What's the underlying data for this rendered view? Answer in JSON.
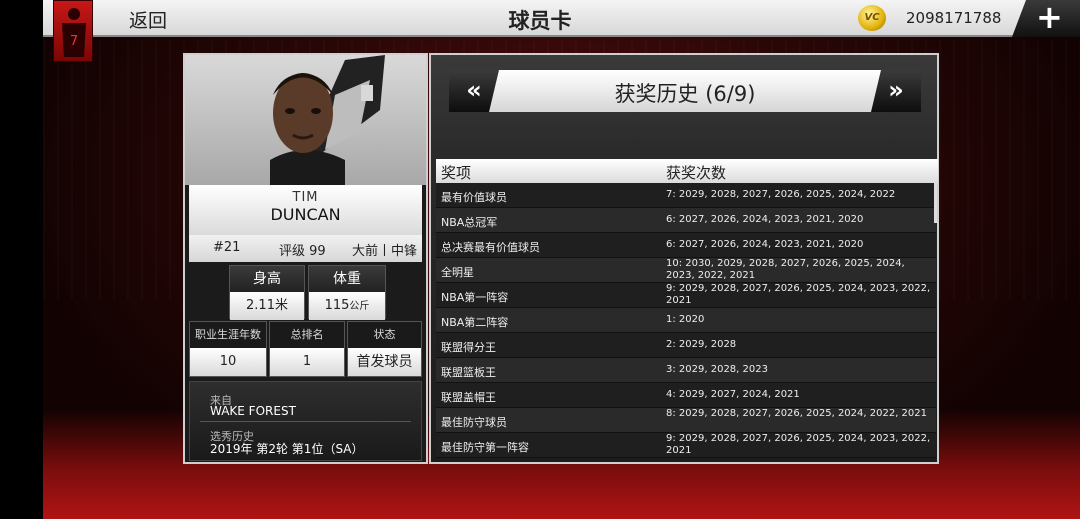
{
  "topbar": {
    "back_label": "返回",
    "title": "球员卡",
    "coin_label": "VC",
    "currency": "2098171788",
    "add_label": "+"
  },
  "player": {
    "first_name": "TIM",
    "last_name": "DUNCAN",
    "number": "#21",
    "rating": "评级 99",
    "position": "大前丨中锋",
    "height_label": "身高",
    "height_value": "2.11米",
    "weight_label": "体重",
    "weight_value": "115",
    "weight_unit": "公斤",
    "career_label": "职业生涯年数",
    "career_value": "10",
    "rank_label": "总排名",
    "rank_value": "1",
    "status_label": "状态",
    "status_value": "首发球员",
    "from_label": "来自",
    "from_value": "WAKE FOREST",
    "draft_label": "选秀历史",
    "draft_value": "2019年 第2轮 第1位（SA）"
  },
  "awards": {
    "title": "获奖历史 (6/9)",
    "prev_label": "«",
    "next_label": "»",
    "col_award": "奖项",
    "col_count": "获奖次数",
    "rows": [
      {
        "name": "最有价值球员",
        "count": "7: 2029, 2028, 2027, 2026, 2025, 2024, 2022"
      },
      {
        "name": "NBA总冠军",
        "count": "6: 2027, 2026, 2024, 2023, 2021, 2020"
      },
      {
        "name": "总决赛最有价值球员",
        "count": "6: 2027, 2026, 2024, 2023, 2021, 2020"
      },
      {
        "name": "全明星",
        "count": "10: 2030, 2029, 2028, 2027, 2026, 2025, 2024, 2023, 2022, 2021"
      },
      {
        "name": "NBA第一阵容",
        "count": "9: 2029, 2028, 2027, 2026, 2025, 2024, 2023, 2022, 2021"
      },
      {
        "name": "NBA第二阵容",
        "count": "1: 2020"
      },
      {
        "name": "联盟得分王",
        "count": "2: 2029, 2028"
      },
      {
        "name": "联盟篮板王",
        "count": "3: 2029, 2028, 2023"
      },
      {
        "name": "联盟盖帽王",
        "count": "4: 2029, 2027, 2024, 2021"
      },
      {
        "name": "最佳防守球员",
        "count": "8: 2029, 2028, 2027, 2026, 2025, 2024, 2022, 2021"
      },
      {
        "name": "最佳防守第一阵容",
        "count": "9: 2029, 2028, 2027, 2026, 2025, 2024, 2023, 2022, 2021"
      }
    ]
  }
}
